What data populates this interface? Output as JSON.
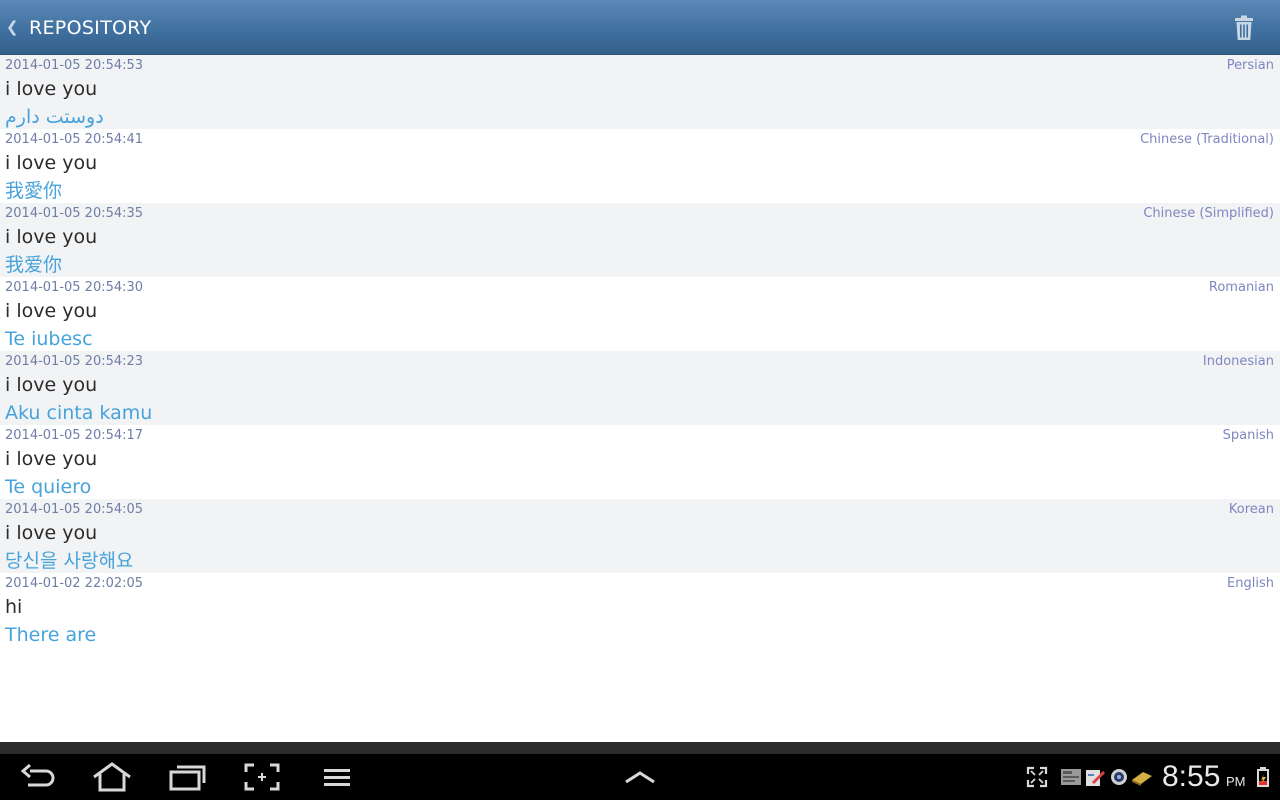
{
  "header": {
    "back_icon": "chevron-left-icon",
    "title": "REPOSITORY",
    "delete_icon": "trash-icon"
  },
  "entries": [
    {
      "timestamp": "2014-01-05 20:54:53",
      "language": "Persian",
      "source": "i love you",
      "translation": "دوستت دارم"
    },
    {
      "timestamp": "2014-01-05 20:54:41",
      "language": "Chinese (Traditional)",
      "source": "i love you",
      "translation": "我愛你"
    },
    {
      "timestamp": "2014-01-05 20:54:35",
      "language": "Chinese (Simplified)",
      "source": "i love you",
      "translation": "我爱你"
    },
    {
      "timestamp": "2014-01-05 20:54:30",
      "language": "Romanian",
      "source": "i love you",
      "translation": "Te iubesc"
    },
    {
      "timestamp": "2014-01-05 20:54:23",
      "language": "Indonesian",
      "source": "i love you",
      "translation": "Aku cinta kamu"
    },
    {
      "timestamp": "2014-01-05 20:54:17",
      "language": "Spanish",
      "source": "i love you",
      "translation": "Te quiero"
    },
    {
      "timestamp": "2014-01-05 20:54:05",
      "language": "Korean",
      "source": "i love you",
      "translation": "당신을 사랑해요"
    },
    {
      "timestamp": "2014-01-02 22:02:05",
      "language": "English",
      "source": "hi",
      "translation": "There are"
    }
  ],
  "system_bar": {
    "nav_icons": [
      "back-icon",
      "home-icon",
      "recent-apps-icon",
      "screenshot-icon",
      "menu-icon"
    ],
    "center_icon": "chevron-up-icon",
    "tray_icons": [
      "fullscreen-icon",
      "notification-app-icon",
      "notification-edit-icon",
      "notification-camera-icon",
      "notification-keyboard-icon"
    ],
    "time": "8:55",
    "ampm": "PM",
    "battery_icon": "battery-icon"
  },
  "colors": {
    "header_top": "#5b88b6",
    "header_bottom": "#345f8b",
    "timestamp": "#6f7da7",
    "language": "#7f86c0",
    "source_text": "#2b2b2b",
    "translation_text": "#47a3dc",
    "row_shaded": "#f2f3f5"
  }
}
